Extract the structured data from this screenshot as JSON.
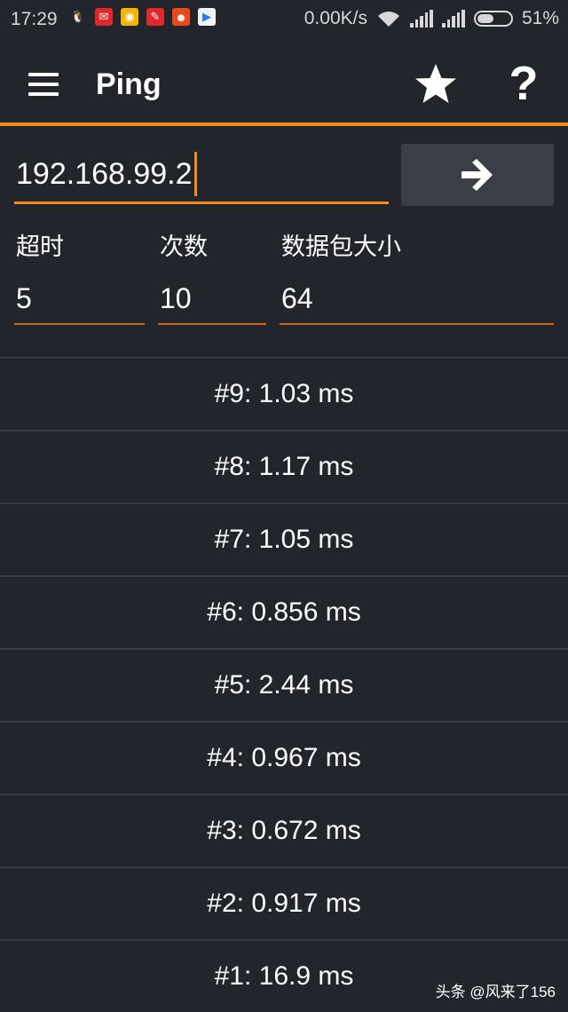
{
  "status_bar": {
    "time": "17:29",
    "network_speed": "0.00K/s",
    "battery_percent": "51%",
    "battery_level": 0.51,
    "notification_icons": [
      {
        "name": "qq-icon",
        "color": "#22252c",
        "glyph": "🐧"
      },
      {
        "name": "app-icon-red-1",
        "color": "#e02828",
        "glyph": "✉"
      },
      {
        "name": "weibo-icon",
        "color": "#f5b400",
        "glyph": "◉"
      },
      {
        "name": "app-icon-red-2",
        "color": "#e02828",
        "glyph": "✎"
      },
      {
        "name": "app-icon-orange",
        "color": "#e84a1a",
        "glyph": "☻"
      },
      {
        "name": "app-icon-white",
        "color": "#f2f2f2",
        "glyph": "▶"
      }
    ]
  },
  "toolbar": {
    "title": "Ping",
    "accent_color": "#f38b14"
  },
  "form": {
    "host_value": "192.168.99.2",
    "timeout_label": "超时",
    "timeout_value": "5",
    "count_label": "次数",
    "count_value": "10",
    "packet_size_label": "数据包大小",
    "packet_size_value": "64"
  },
  "results": [
    "#9: 1.03 ms",
    "#8: 1.17 ms",
    "#7: 1.05 ms",
    "#6: 0.856 ms",
    "#5: 2.44 ms",
    "#4: 0.967 ms",
    "#3: 0.672 ms",
    "#2: 0.917 ms",
    "#1: 16.9 ms"
  ],
  "watermark": "头条 @风来了156"
}
